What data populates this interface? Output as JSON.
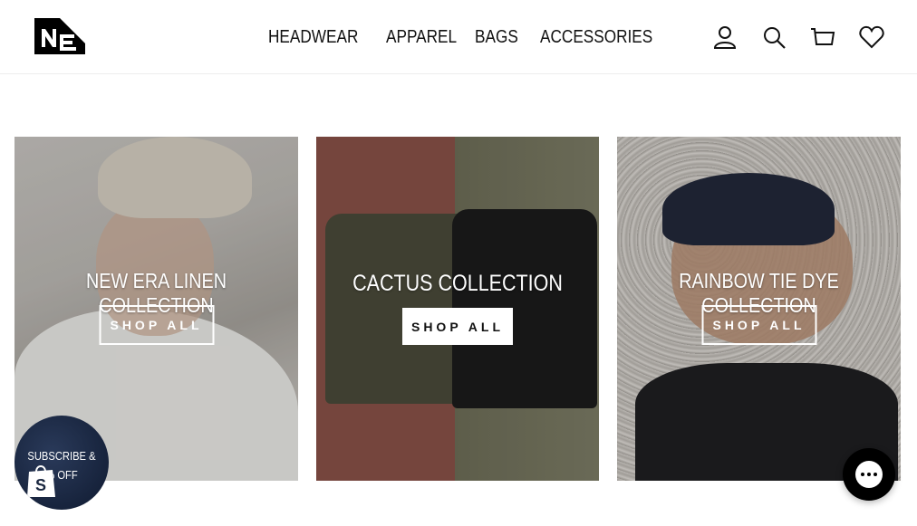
{
  "header": {
    "logo": "new-era-flag-logo",
    "nav": [
      {
        "label": "HEADWEAR"
      },
      {
        "label": "APPAREL"
      },
      {
        "label": "BAGS"
      },
      {
        "label": "ACCESSORIES"
      }
    ],
    "icons": [
      "account-icon",
      "search-icon",
      "cart-icon",
      "wishlist-heart-icon"
    ]
  },
  "collections": [
    {
      "title": "NEW ERA LINEN COLLECTION",
      "button": "SHOP ALL",
      "button_style": "outline"
    },
    {
      "title": "CACTUS COLLECTION",
      "button": "SHOP ALL",
      "button_style": "solid"
    },
    {
      "title": "RAINBOW TIE DYE COLLECTION",
      "button": "SHOP ALL",
      "button_style": "outline"
    }
  ],
  "promo": {
    "line1": "SUBSCRIBE &",
    "line2": "% OFF"
  },
  "chat": {
    "icon": "chat-bubble-icon"
  },
  "colors": {
    "text": "#111111",
    "background": "#ffffff",
    "chat": "#000000"
  }
}
